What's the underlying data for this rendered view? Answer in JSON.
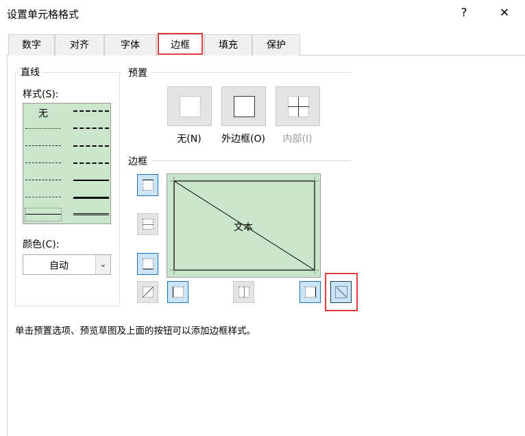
{
  "window": {
    "title": "设置单元格格式",
    "help": "?",
    "close": "✕"
  },
  "tabs": [
    {
      "label": "数字"
    },
    {
      "label": "对齐"
    },
    {
      "label": "字体"
    },
    {
      "label": "边框",
      "active": true
    },
    {
      "label": "填充"
    },
    {
      "label": "保护"
    }
  ],
  "line": {
    "group_label": "直线",
    "style_label": "样式(S):",
    "none_label": "无",
    "color_label": "颜色(C):",
    "color_value": "自动"
  },
  "presets": {
    "label": "预置",
    "items": [
      {
        "label": "无(N)"
      },
      {
        "label": "外边框(O)"
      },
      {
        "label": "内部(I)",
        "disabled": true
      }
    ]
  },
  "border": {
    "label": "边框",
    "preview_text": "文本"
  },
  "help_text": "单击预置选项、预览草图及上面的按钮可以添加边框样式。",
  "colors": {
    "accent": "#e03a3a",
    "preview_bg": "#c9e6cb",
    "active_btn": "#cce4f7"
  }
}
